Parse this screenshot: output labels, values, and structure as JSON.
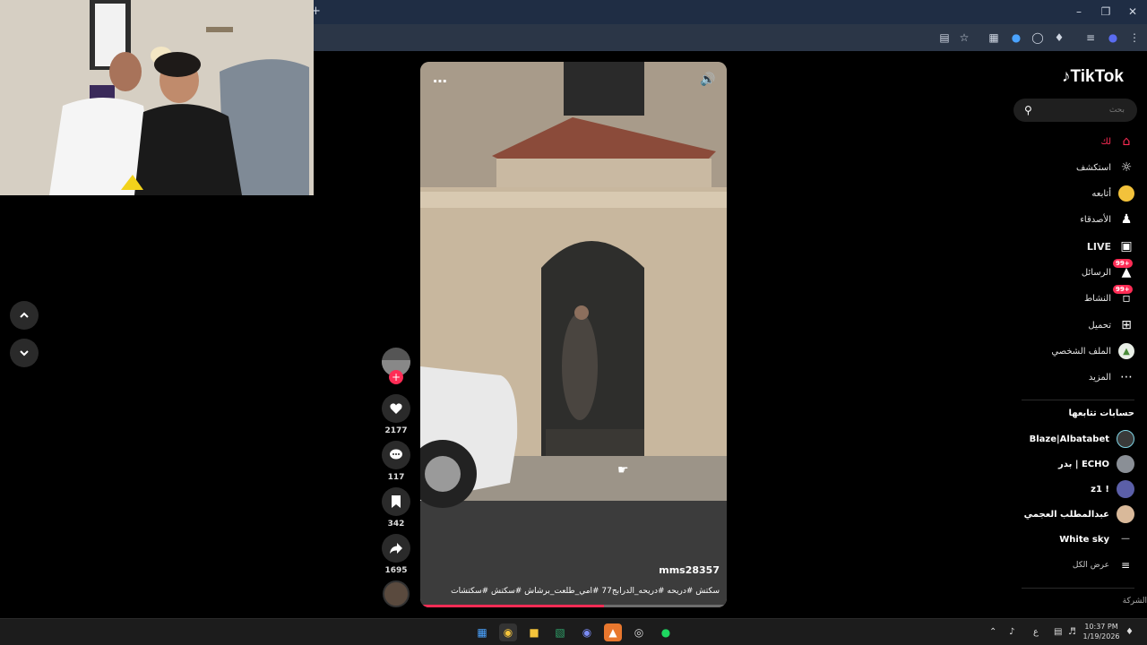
{
  "browser": {
    "new_tab_label": "+",
    "window_controls": [
      "minimize-icon",
      "restore-icon",
      "close-icon"
    ],
    "toolbar_icons": [
      "install-icon",
      "star-icon",
      "extension-1-icon",
      "extension-2-icon",
      "shield-extension-icon",
      "puzzle-icon",
      "queue-icon",
      "profile-icon",
      "more-icon"
    ]
  },
  "video": {
    "username": "mms28357",
    "caption": "سكتش #دريحه #دريحه_الدرابج77 #امي_طلعت_برشاش #سكتش #سكتشات",
    "progress": 0.6
  },
  "actions": {
    "likes": "2177",
    "comments": "117",
    "saves": "342",
    "shares": "1695"
  },
  "sidebar": {
    "logo": "TikTok",
    "search_placeholder": "بحث",
    "nav": [
      {
        "label": "لك",
        "icon": "home-icon",
        "active": true
      },
      {
        "label": "استكشف",
        "icon": "compass-icon"
      },
      {
        "label": "أتابعه",
        "icon": "following-avatar-icon"
      },
      {
        "label": "الأصدقاء",
        "icon": "friends-icon"
      },
      {
        "label": "LIVE",
        "icon": "live-icon"
      },
      {
        "label": "الرسائل",
        "icon": "messages-icon",
        "badge": "99+"
      },
      {
        "label": "النشاط",
        "icon": "activity-icon",
        "badge": "99+"
      },
      {
        "label": "تحميل",
        "icon": "upload-icon"
      },
      {
        "label": "الملف الشخصي",
        "icon": "profile-avatar-icon"
      },
      {
        "label": "المزيد",
        "icon": "more-dots-icon"
      }
    ],
    "following_title": "حسابات تتابعها",
    "following": [
      {
        "name": "Blaze|Albatabet"
      },
      {
        "name": "بدر | ECHO"
      },
      {
        "name": "z1 !"
      },
      {
        "name": "عبدالمطلب العجمي"
      },
      {
        "name": "White sky"
      }
    ],
    "see_all": "عرض الكل",
    "company_label": "الشركة"
  },
  "taskbar": {
    "time": "10:37 PM",
    "date": "1/19/2026",
    "lang": "ع"
  },
  "colors": {
    "accent": "#fe2c55",
    "background": "#000000"
  }
}
